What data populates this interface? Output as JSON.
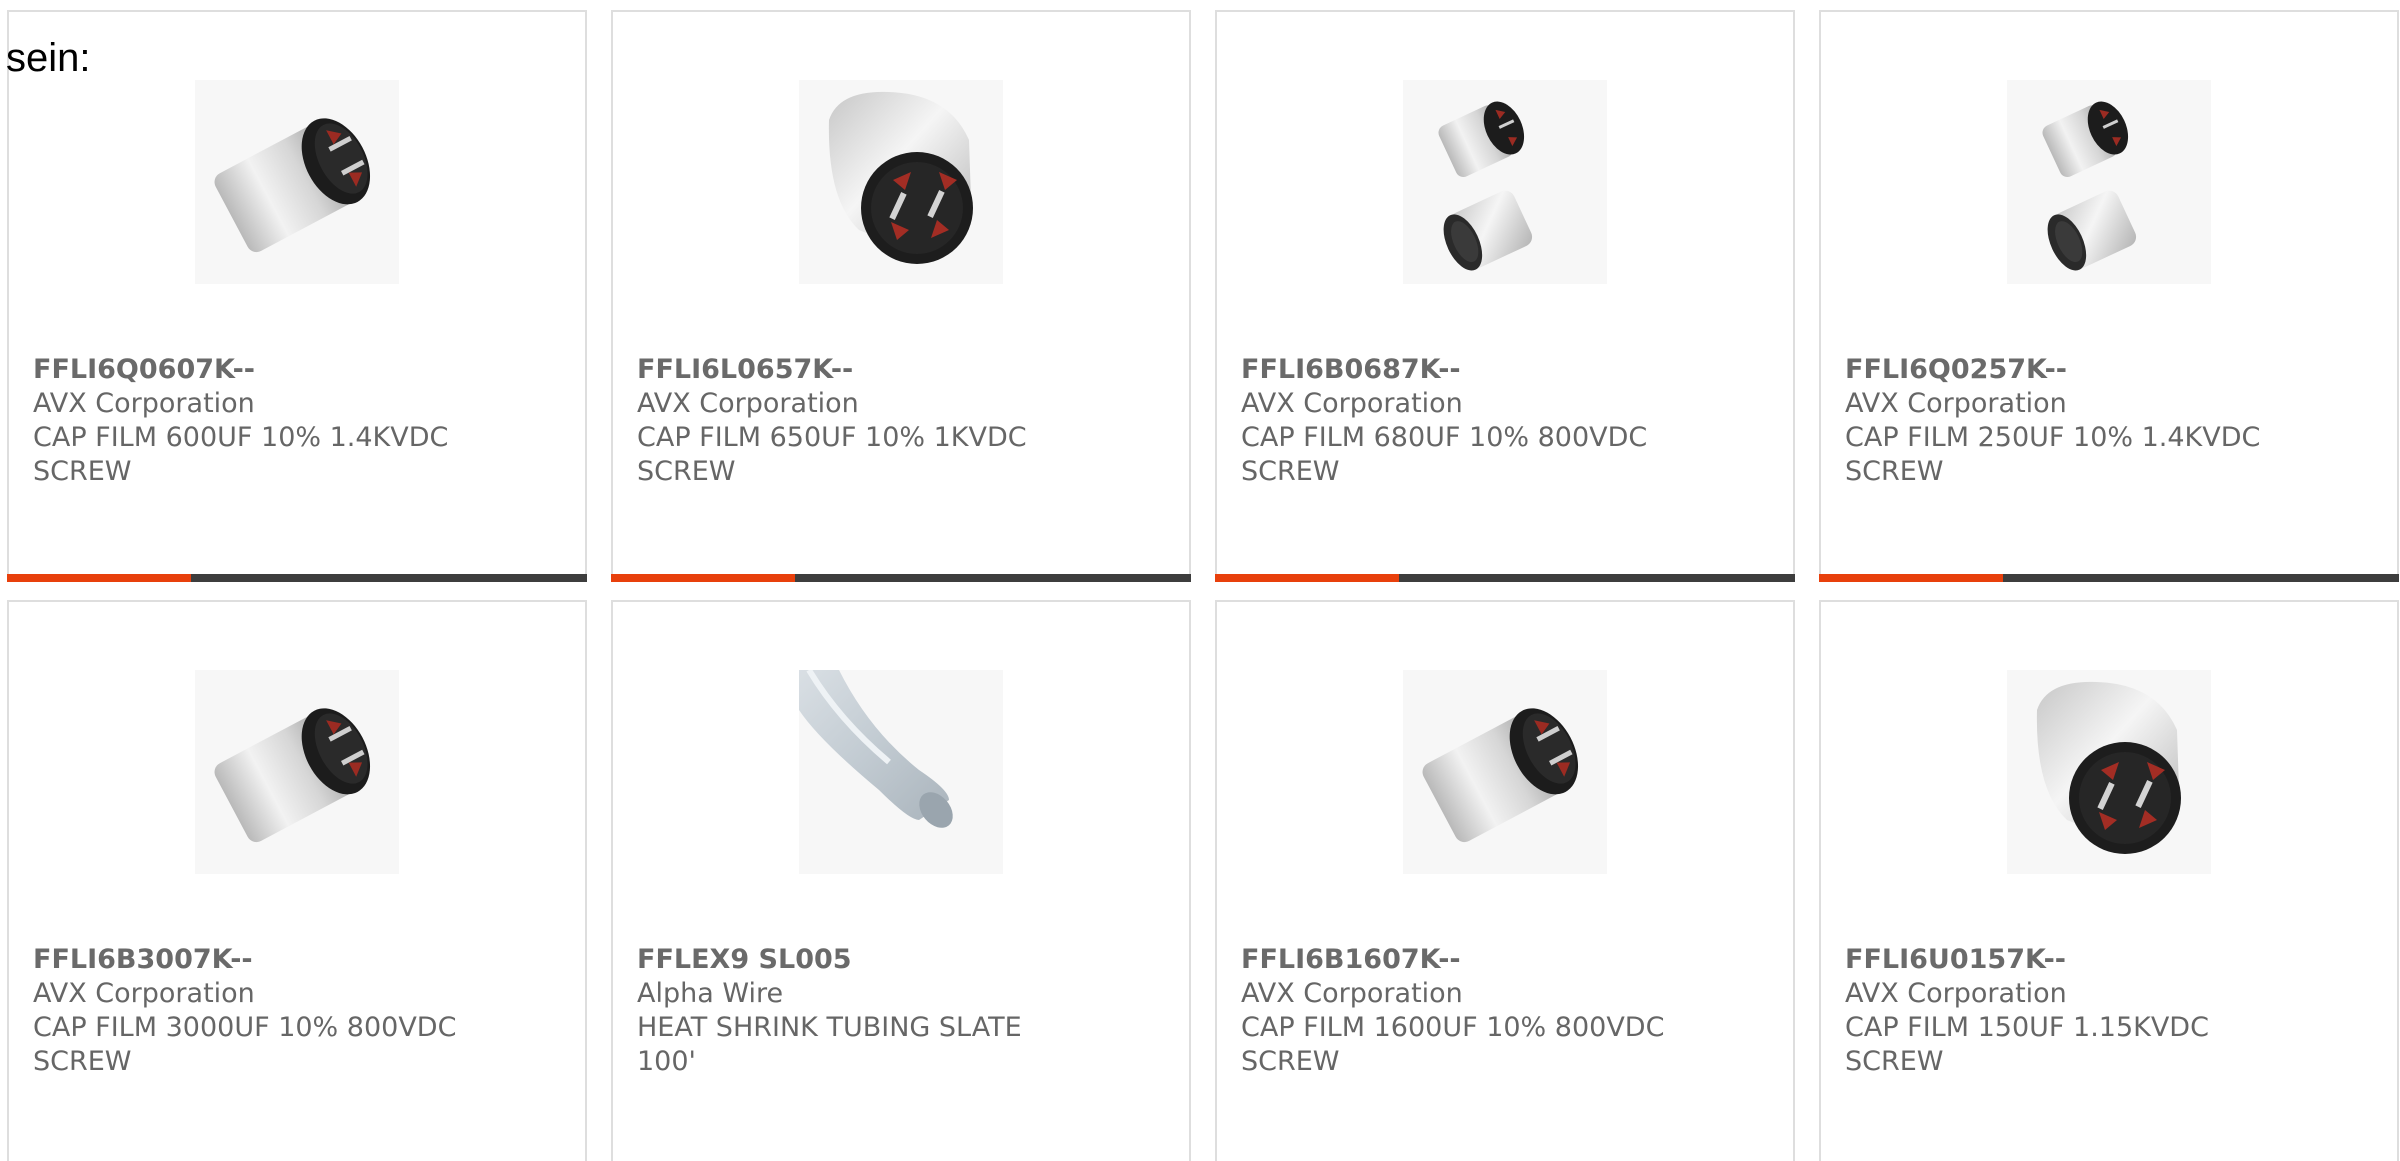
{
  "intro": "sein:",
  "colors": {
    "accent": "#e8400c",
    "bar": "#3d3d3d",
    "card_border": "#dedede",
    "text": "#666666"
  },
  "products": [
    {
      "part_number": "FFLI6Q0607K--",
      "manufacturer": "AVX Corporation",
      "description": "CAP FILM 600UF 10% 1.4KVDC SCREW",
      "image": "capacitor-cylinder-side-icon"
    },
    {
      "part_number": "FFLI6L0657K--",
      "manufacturer": "AVX Corporation",
      "description": "CAP FILM 650UF 10% 1KVDC SCREW",
      "image": "capacitor-cylinder-front-icon"
    },
    {
      "part_number": "FFLI6B0687K--",
      "manufacturer": "AVX Corporation",
      "description": "CAP FILM 680UF 10% 800VDC SCREW",
      "image": "capacitor-pair-icon"
    },
    {
      "part_number": "FFLI6Q0257K--",
      "manufacturer": "AVX Corporation",
      "description": "CAP FILM 250UF 10% 1.4KVDC SCREW",
      "image": "capacitor-pair-icon"
    },
    {
      "part_number": "FFLI6B3007K--",
      "manufacturer": "AVX Corporation",
      "description": "CAP FILM 3000UF 10% 800VDC SCREW",
      "image": "capacitor-cylinder-side-icon"
    },
    {
      "part_number": "FFLEX9 SL005",
      "manufacturer": "Alpha Wire",
      "description": "HEAT SHRINK TUBING SLATE 100'",
      "image": "heat-shrink-tubing-icon"
    },
    {
      "part_number": "FFLI6B1607K--",
      "manufacturer": "AVX Corporation",
      "description": "CAP FILM 1600UF 10% 800VDC SCREW",
      "image": "capacitor-cylinder-side-icon"
    },
    {
      "part_number": "FFLI6U0157K--",
      "manufacturer": "AVX Corporation",
      "description": "CAP FILM 150UF 1.15KVDC SCREW",
      "image": "capacitor-cylinder-front-icon"
    }
  ]
}
